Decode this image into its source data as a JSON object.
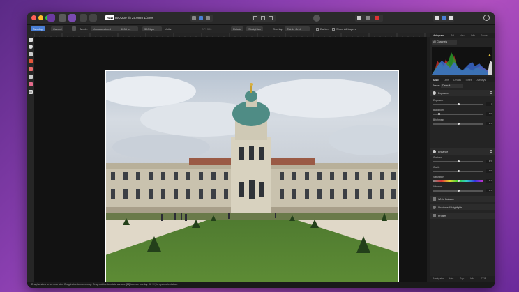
{
  "titlebar": {
    "camera_badge": "RAW",
    "camera_info": "ISO 200 f/8 25.0mm 1/320s"
  },
  "context_toolbar": {
    "develop_label": "Develop",
    "cancel_label": "Cancel",
    "mode_label": "Mode:",
    "mode_value": "Unconstrained",
    "width_value": "5208 px",
    "height_value": "3904 px",
    "units_label": "Units:",
    "dpi_value": "DPI 300",
    "rotate_label": "Rotate",
    "straighten_label": "Straighten",
    "overlay_label": "Overlay:",
    "overlay_value": "Thirds Grid",
    "darken_label": "Darken",
    "show_layers_label": "Show All Layers"
  },
  "panel": {
    "top_tabs": [
      "Histogram",
      "Pal",
      "Nav",
      "Info",
      "Focus"
    ],
    "channel_value": "All Channels",
    "tabs": [
      "Basic",
      "Lens",
      "Details",
      "Tones",
      "Overlays"
    ],
    "preset_label": "Preset:",
    "preset_value": "Default",
    "exposure": {
      "title": "Exposure",
      "rows": [
        {
          "label": "Exposure",
          "value": "0",
          "level": 0.5
        },
        {
          "label": "Blackpoint",
          "value": "0 %",
          "level": 0.12
        },
        {
          "label": "Brightness",
          "value": "0 %",
          "level": 0.5
        }
      ]
    },
    "enhance": {
      "title": "Enhance",
      "rows": [
        {
          "label": "Contrast",
          "value": "0 %",
          "level": 0.5
        },
        {
          "label": "Clarity",
          "value": "0 %",
          "level": 0.5
        },
        {
          "label": "Saturation",
          "value": "0 %",
          "level": 0.5
        },
        {
          "label": "Vibrance",
          "value": "0 %",
          "level": 0.5
        }
      ]
    },
    "sections": [
      "White Balance",
      "Shadows & Highlights",
      "Profiles"
    ],
    "bottom_tabs": [
      "Navigator",
      "Hist",
      "Scp",
      "Info",
      "EXIF"
    ]
  },
  "status": {
    "text": "Drag handles to set crop size. Drag inside to move crop. Drag outside to rotate canvas. [⌘] to cycle overlay. [⌘+⇧] to cycle orientation."
  },
  "colors": {
    "accent": "#4a7fd4",
    "background": "#1e1e1e"
  }
}
